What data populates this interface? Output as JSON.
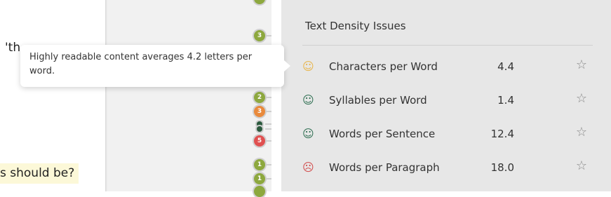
{
  "document": {
    "fragment_top": "'th",
    "fragment_highlight": "s should be?"
  },
  "gutter": {
    "markers": [
      {
        "label": "3",
        "color": "green"
      },
      {
        "label": "2",
        "color": "green"
      },
      {
        "label": "3",
        "color": "orange"
      },
      {
        "label": "",
        "color": "dark"
      },
      {
        "label": "5",
        "color": "red"
      },
      {
        "label": "1",
        "color": "green"
      },
      {
        "label": "1",
        "color": "green"
      }
    ]
  },
  "tooltip": {
    "text": "Highly readable content averages 4.2 letters per word."
  },
  "panel": {
    "title": "Text Density Issues",
    "rows": [
      {
        "face": "☺",
        "status": "warning",
        "label": "Characters per Word",
        "value": "4.4",
        "star": "☆"
      },
      {
        "face": "☺",
        "status": "ok",
        "label": "Syllables per Word",
        "value": "1.4",
        "star": "☆"
      },
      {
        "face": "☺",
        "status": "ok",
        "label": "Words per Sentence",
        "value": "12.4",
        "star": "☆"
      },
      {
        "face": "☹",
        "status": "bad",
        "label": "Words per Paragraph",
        "value": "18.0",
        "star": "☆"
      }
    ]
  },
  "colors": {
    "warning": "#e8b54a",
    "ok": "#2f6f52",
    "bad": "#d24c4c",
    "marker_green": "#8da83e",
    "marker_orange": "#e98a3c",
    "marker_red": "#e05050"
  }
}
